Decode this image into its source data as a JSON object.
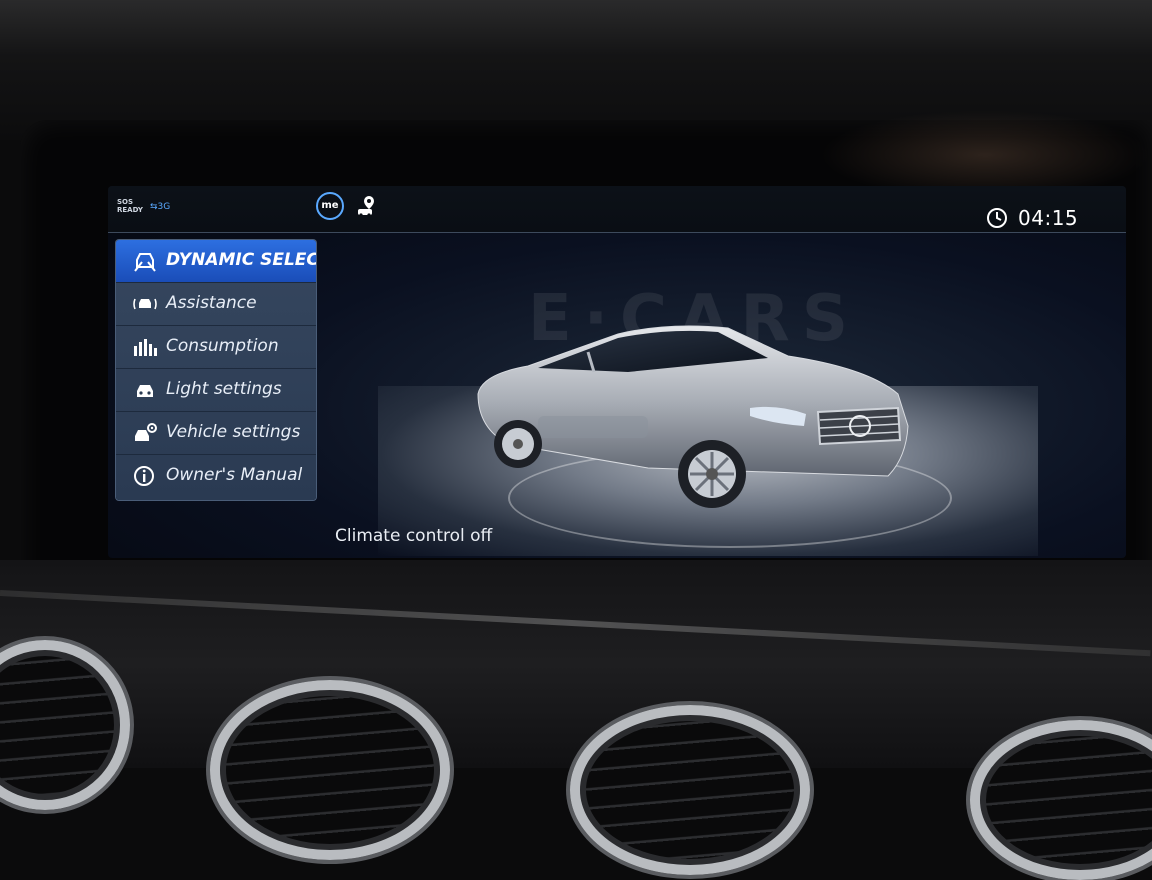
{
  "status_bar": {
    "sos_line1": "SOS",
    "sos_line2": "READY",
    "network": "3G",
    "me_icon": "me",
    "time": "04:15"
  },
  "menu": {
    "items": [
      {
        "label": "DYNAMIC SELECT",
        "icon": "dynamic-select-icon",
        "selected": true
      },
      {
        "label": "Assistance",
        "icon": "assistance-icon",
        "selected": false
      },
      {
        "label": "Consumption",
        "icon": "consumption-icon",
        "selected": false
      },
      {
        "label": "Light settings",
        "icon": "light-settings-icon",
        "selected": false
      },
      {
        "label": "Vehicle settings",
        "icon": "vehicle-settings-icon",
        "selected": false
      },
      {
        "label": "Owner's Manual",
        "icon": "info-icon",
        "selected": false
      }
    ]
  },
  "status_message": "Climate control off",
  "colors": {
    "accent": "#2d6fe0",
    "menu_bg": "#36475f",
    "network_blue": "#5aa9ff"
  }
}
